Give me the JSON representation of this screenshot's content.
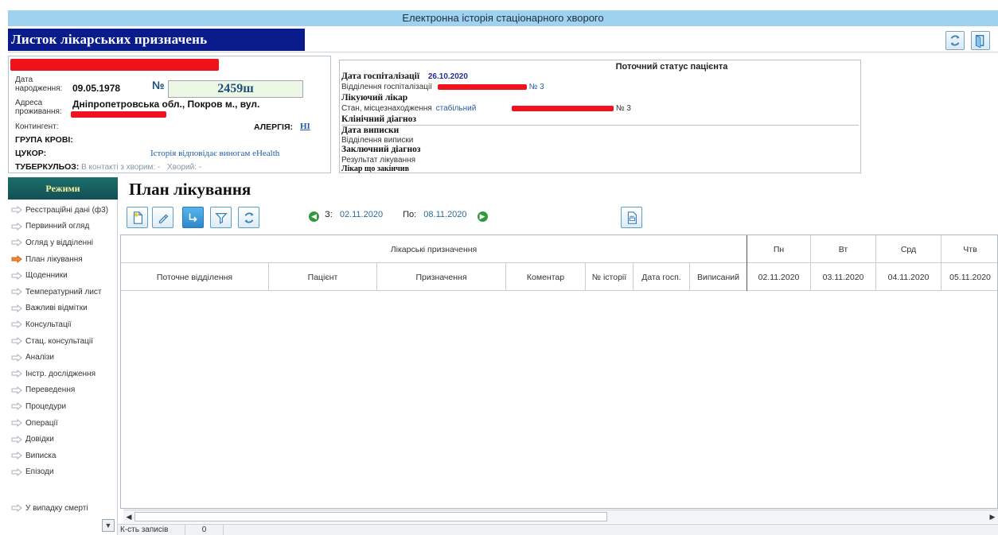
{
  "window": {
    "title": "Електронна історія стаціонарного хворого"
  },
  "header": {
    "doc_title": "Листок лікарських призначень",
    "icons": [
      "refresh-icon",
      "exit-icon"
    ]
  },
  "patient": {
    "birth_label_1": "Дата",
    "birth_label_2": "народження:",
    "birth_date": "09.05.1978",
    "number_label": "№",
    "number": "2459ш",
    "address_label_1": "Адреса",
    "address_label_2": "проживання:",
    "address": "Дніпропетровська обл., Покров м., вул.",
    "contingent_label": "Контингент:",
    "allergy_label": "АЛЕРГІЯ:",
    "allergy_value": "НІ",
    "blood_group_label": "ГРУПА КРОВІ:",
    "diabetes_label": "ЦУКОР:",
    "ehealth_link": "Історія відповідає виногам eHealth",
    "tb_label": "ТУБЕРКУЛЬОЗ:",
    "tb_contact": "В контакті з хворим: -",
    "tb_sick": "Хворий: -"
  },
  "status": {
    "title": "Поточний статус пацієнта",
    "hosp_date_label": "Дата госпіталізації",
    "hosp_date": "26.10.2020",
    "hosp_dept_label": "Відділення госпіталізації",
    "hosp_dept_suffix": "№ 3",
    "doctor_label": "Лікуючий лікар",
    "state_label": "Стан, місцезнаходження",
    "state_value": "стабільний",
    "state_suffix": "№ 3",
    "clin_diag_label": "Клінічний діагноз",
    "discharge_date_label": "Дата виписки",
    "discharge_dept_label": "Відділення виписки",
    "final_diag_label": "Заключний діагноз",
    "result_label": "Результат лікування",
    "closing_doctor_label": "Лікар що закінчив"
  },
  "nav": {
    "header": "Режими",
    "items": [
      {
        "label": "Реєстраційні дані (ф3)",
        "active": false
      },
      {
        "label": "Первинний огляд",
        "active": false
      },
      {
        "label": "Огляд у відділенні",
        "active": false
      },
      {
        "label": "План лікування",
        "active": true
      },
      {
        "label": "Щоденники",
        "active": false
      },
      {
        "label": "Температурний лист",
        "active": false
      },
      {
        "label": "Важливі відмітки",
        "active": false
      },
      {
        "label": "Консультації",
        "active": false
      },
      {
        "label": "Стац. консультації",
        "active": false
      },
      {
        "label": "Аналізи",
        "active": false
      },
      {
        "label": "Інстр. дослідження",
        "active": false
      },
      {
        "label": "Переведення",
        "active": false
      },
      {
        "label": "Процедури",
        "active": false
      },
      {
        "label": "Операції",
        "active": false
      },
      {
        "label": "Довідки",
        "active": false
      },
      {
        "label": "Виписка",
        "active": false
      },
      {
        "label": "Епізоди",
        "active": false
      }
    ],
    "bottom_item": "У випадку смерті"
  },
  "main": {
    "title": "План лікування",
    "date_from_label": "З:",
    "date_from": "02.11.2020",
    "date_to_label": "По:",
    "date_to": "08.11.2020",
    "toolbar_icons": [
      "add-document-icon",
      "edit-pencil-icon",
      "arrow-down-right-icon",
      "filter-icon",
      "refresh-icon"
    ],
    "print_icon": "print-icon"
  },
  "grid": {
    "group_header": "Лікарські призначення",
    "day_headers": [
      "Пн",
      "Вт",
      "Срд",
      "Чтв"
    ],
    "columns": [
      "Поточне відділення",
      "Пацієнт",
      "Призначення",
      "Коментар",
      "№ історії",
      "Дата госп.",
      "Виписаний"
    ],
    "dates": [
      "02.11.2020",
      "03.11.2020",
      "04.11.2020",
      "05.11.2020"
    ],
    "rows": []
  },
  "statusbar": {
    "records_label": "К-сть записів",
    "records_count": "0"
  },
  "colors": {
    "title_bar": "#9fd2ee",
    "doc_title_bg": "#0a1c8c",
    "nav_header_bg": "#1b6f6a",
    "nav_header_text": "#fbf49c",
    "redaction": "#f0131e"
  }
}
